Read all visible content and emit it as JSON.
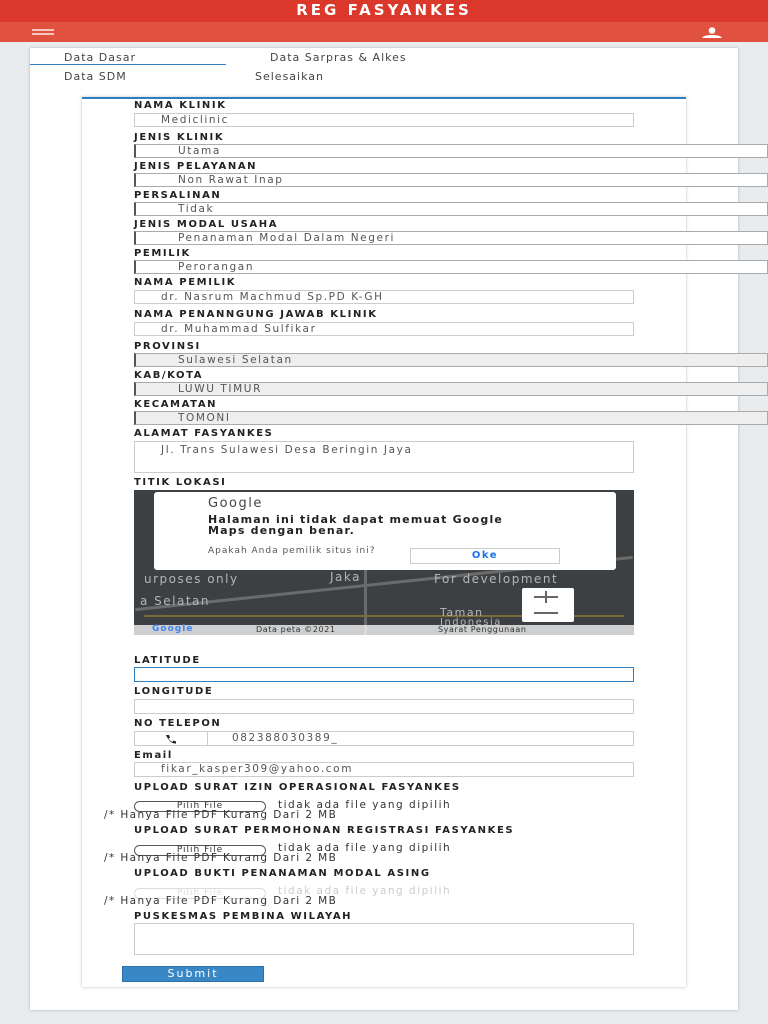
{
  "app": {
    "title": "REG FASYANKES"
  },
  "tabs": [
    {
      "label": "Data Dasar"
    },
    {
      "label": "Data Sarpras & Alkes"
    },
    {
      "label": "Data SDM"
    },
    {
      "label": "Selesaikan"
    }
  ],
  "form": {
    "nama_klinik": {
      "label": "NAMA KLINIK",
      "value": "Mediclinic"
    },
    "jenis_klinik": {
      "label": "JENIS KLINIK",
      "value": "Utama"
    },
    "jenis_pelayanan": {
      "label": "JENIS PELAYANAN",
      "value": "Non Rawat Inap"
    },
    "persalinan": {
      "label": "PERSALINAN",
      "value": "Tidak"
    },
    "jenis_modal": {
      "label": "JENIS MODAL USAHA",
      "value": "Penanaman Modal Dalam Negeri"
    },
    "pemilik": {
      "label": "PEMILIK",
      "value": "Perorangan"
    },
    "nama_pemilik": {
      "label": "NAMA PEMILIK",
      "value": "dr. Nasrum Machmud Sp.PD K-GH"
    },
    "penanggung_jawab": {
      "label": "NAMA PENANNGUNG JAWAB KLINIK",
      "value": "dr. Muhammad Sulfikar"
    },
    "provinsi": {
      "label": "PROVINSI",
      "value": "Sulawesi Selatan"
    },
    "kabkota": {
      "label": "KAB/KOTA",
      "value": "LUWU TIMUR"
    },
    "kecamatan": {
      "label": "KECAMATAN",
      "value": "TOMONI"
    },
    "alamat": {
      "label": "ALAMAT FASYANKES",
      "value": "Jl. Trans Sulawesi Desa Beringin Jaya"
    },
    "titik_lokasi": {
      "label": "TITIK LOKASI"
    },
    "latitude": {
      "label": "LATITUDE",
      "value": ""
    },
    "longitude": {
      "label": "LONGITUDE",
      "value": ""
    },
    "telepon": {
      "label": "NO TELEPON",
      "value": "082388030389_"
    },
    "email": {
      "label": "Email",
      "value": "fikar_kasper309@yahoo.com"
    },
    "upload_izin": {
      "label": "UPLOAD SURAT IZIN OPERASIONAL FASYANKES"
    },
    "upload_permohonan": {
      "label": "UPLOAD SURAT PERMOHONAN REGISTRASI FASYANKES"
    },
    "upload_modal_asing": {
      "label": "UPLOAD BUKTI PENANAMAN MODAL ASING"
    },
    "puskesmas": {
      "label": "PUSKESMAS PEMBINA WILAYAH",
      "value": ""
    }
  },
  "file": {
    "button": "Pilih File",
    "none": "tidak ada file yang dipilih",
    "hint": "/* Hanya File PDF Kurang Dari 2 MB"
  },
  "map": {
    "dialog_brand": "Google",
    "dialog_message": "Halaman ini tidak dapat memuat Google Maps dengan benar.",
    "dialog_question": "Apakah Anda pemilik situs ini?",
    "ok": "Oke",
    "wm_purposes": "urposes only",
    "wm_jakarta": "Jaka",
    "wm_dev": "For development",
    "wm_selatan": "a Selatan",
    "wm_tamar": "Taman",
    "wm_indonesia": "Indonesia",
    "footer_data": "Data peta ©2021",
    "footer_terms": "Syarat Penggunaan",
    "logo": "Google"
  },
  "submit": "Submit"
}
